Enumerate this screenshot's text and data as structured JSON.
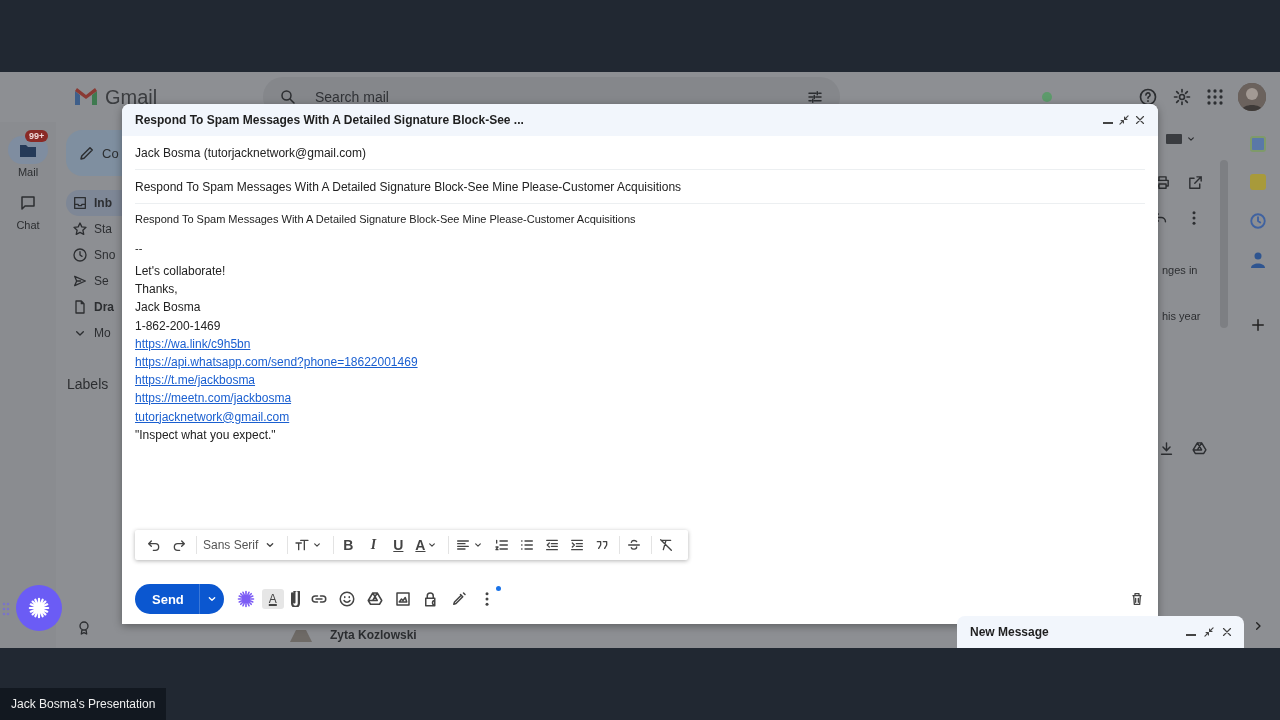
{
  "gmail": {
    "logo": "Gmail",
    "search": {
      "placeholder": "Search mail"
    },
    "rail": [
      {
        "label": "Mail",
        "badge": "99+",
        "kind": "mail",
        "selected": true
      },
      {
        "label": "Chat",
        "kind": "chat",
        "selected": false
      }
    ],
    "compose_button": "Co",
    "nav": [
      {
        "label": "Inb",
        "kind": "inbox",
        "selected": true,
        "unread": true
      },
      {
        "label": "Sta",
        "kind": "star",
        "selected": false,
        "unread": false
      },
      {
        "label": "Sno",
        "kind": "clock",
        "selected": false,
        "unread": false
      },
      {
        "label": "Se",
        "kind": "send",
        "selected": false,
        "unread": false
      },
      {
        "label": "Dra",
        "kind": "draft",
        "selected": false,
        "unread": true
      },
      {
        "label": "Mo",
        "kind": "more",
        "selected": false,
        "unread": false
      }
    ],
    "labels_heading": "Labels",
    "snippets": [
      "nges in",
      "his year"
    ],
    "sender": "Zyta Kozlowski"
  },
  "compose": {
    "title": "Respond To Spam Messages With A Detailed Signature Block-See ...",
    "from": "Jack Bosma (tutorjacknetwork@gmail.com)",
    "subject": "Respond To Spam Messages With A Detailed Signature Block-See Mine Please-Customer Acquisitions",
    "body": [
      {
        "kind": "heading",
        "text": "Respond To Spam Messages With A Detailed Signature Block-See Mine Please-Customer Acquisitions"
      },
      {
        "kind": "separator",
        "text": "--"
      },
      {
        "kind": "text",
        "text": "Let's collaborate!"
      },
      {
        "kind": "text",
        "text": "Thanks,"
      },
      {
        "kind": "text",
        "text": "Jack Bosma"
      },
      {
        "kind": "text",
        "text": "1-862-200-1469"
      },
      {
        "kind": "link",
        "text": "https://wa.link/c9h5bn"
      },
      {
        "kind": "link",
        "text": "https://api.whatsapp.com/send?phone=18622001469"
      },
      {
        "kind": "link",
        "text": "https://t.me/jackbosma"
      },
      {
        "kind": "link",
        "text": "https://meetn.com/jackbosma"
      },
      {
        "kind": "link",
        "text": "tutorjacknetwork@gmail.com"
      },
      {
        "kind": "text",
        "text": "\"Inspect what you expect.\""
      }
    ],
    "format_tools": [
      {
        "kind": "undo"
      },
      {
        "kind": "redo"
      },
      {
        "kind": "font",
        "label": "Sans Serif"
      },
      {
        "kind": "size"
      },
      {
        "kind": "bold",
        "glyph": "B"
      },
      {
        "kind": "italic",
        "glyph": "I"
      },
      {
        "kind": "underline",
        "glyph": "U"
      },
      {
        "kind": "color",
        "glyph": "A"
      },
      {
        "kind": "align"
      },
      {
        "kind": "numbered"
      },
      {
        "kind": "bulleted"
      },
      {
        "kind": "outdent"
      },
      {
        "kind": "indent"
      },
      {
        "kind": "quote"
      },
      {
        "kind": "strike"
      },
      {
        "kind": "clear"
      }
    ],
    "send": "Send",
    "actions": [
      {
        "kind": "sparkle"
      },
      {
        "kind": "format",
        "glyph": "A",
        "selected": true
      },
      {
        "kind": "attach"
      },
      {
        "kind": "link"
      },
      {
        "kind": "emoji"
      },
      {
        "kind": "drive"
      },
      {
        "kind": "photo"
      },
      {
        "kind": "confidential"
      },
      {
        "kind": "signature"
      },
      {
        "kind": "more",
        "notification": true
      }
    ]
  },
  "minimized": {
    "title": "New Message"
  },
  "presenter": {
    "label": "Jack Bosma's Presentation"
  }
}
